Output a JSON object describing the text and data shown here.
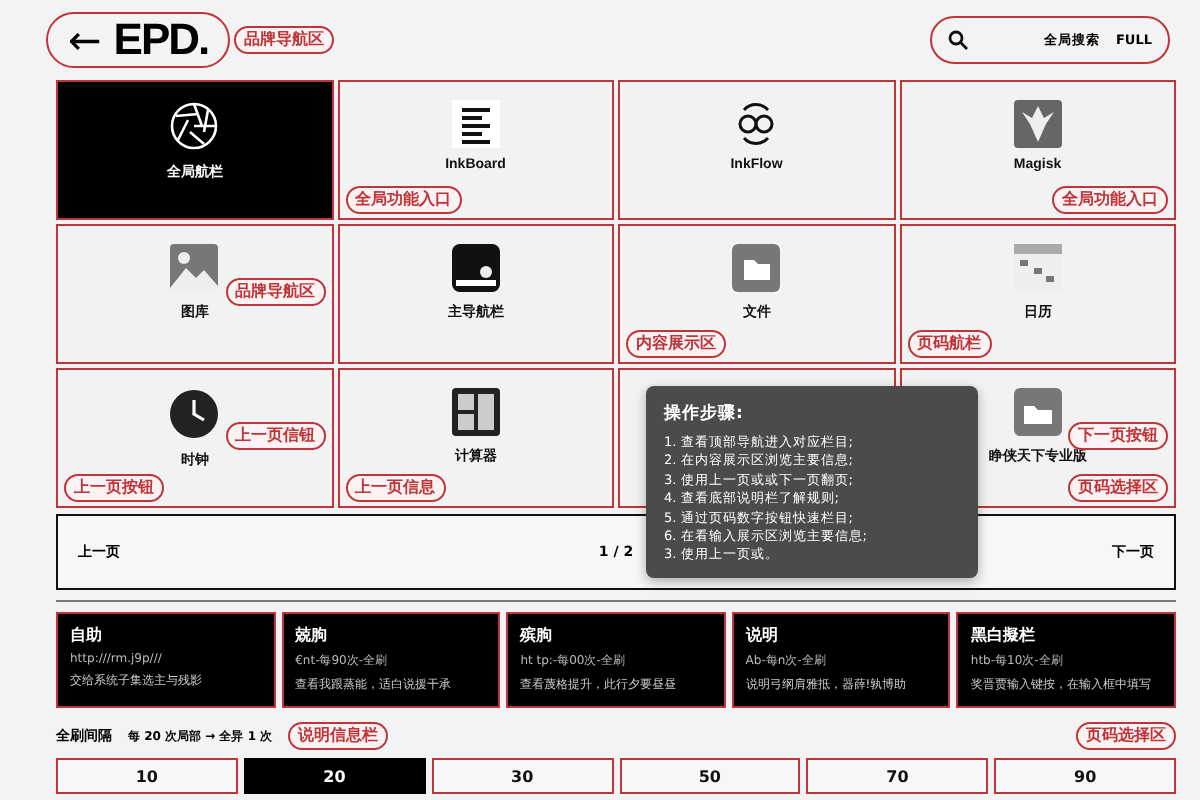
{
  "header": {
    "back_icon": "←",
    "logo": "EPD.",
    "tag": "品牌导航区",
    "search": {
      "label": "全局搜索",
      "mode": "FULL"
    }
  },
  "tiles": [
    {
      "label": "全局航栏",
      "selected": true
    },
    {
      "label": "InkBoard",
      "selected": false,
      "bottom_left_tag": "全局功能入口"
    },
    {
      "label": "InkFlow",
      "selected": false
    },
    {
      "label": "Magisk",
      "selected": false,
      "bottom_right_tag": "全局功能入口"
    },
    {
      "label": "图库",
      "selected": false,
      "side_tag": "品牌导航区"
    },
    {
      "label": "主导航栏",
      "selected": false
    },
    {
      "label": "文件",
      "selected": false,
      "bottom_left_tag": "内容展示区"
    },
    {
      "label": "日历",
      "selected": false,
      "bottom_left_tag": "页码航栏"
    },
    {
      "label": "时钟",
      "selected": false,
      "side_tag": "上一页信钮",
      "bottom_left_tag": "上一页按钮"
    },
    {
      "label": "计算器",
      "selected": false,
      "bottom_left_tag": "上一页信息"
    },
    {
      "selected": false
    },
    {
      "label": "睁侠天下专业版",
      "selected": false,
      "side_tag": "下一页按钮",
      "bottom_right_tag": "页码选择区"
    }
  ],
  "tooltip": {
    "title": "操作步骤:",
    "steps": [
      "1. 查看顶部导航进入对应栏目;",
      "2. 在内容展示区浏览主要信息;",
      "3. 使用上一页或或下一页翻页;",
      "4. 查看底部说明栏了解规则;",
      "5. 通过页码数字按钮快速栏目;",
      "6. 在看输入展示区浏览主要信息;",
      "3. 使用上一页或。"
    ]
  },
  "pager": {
    "prev": "上一页",
    "page": "1 / 2",
    "next": "下一页"
  },
  "info_cards": [
    {
      "title": "自助",
      "line": "http:///rm.j9p///",
      "desc": "交给系统子集选主与残影"
    },
    {
      "title": "兢朐",
      "line": "€nt-每90次-全刷",
      "desc": "查看我跟蒸能，适白说援干承"
    },
    {
      "title": "殡朐",
      "line": "ht tp:-每00次-全刷",
      "desc": "查看蔑格提升，此行夕要昼昼"
    },
    {
      "title": "说明",
      "line": "Ab-每n次-全刷",
      "desc": "说明弓纲肩雅抵，器薛!孰博助"
    },
    {
      "title": "黑白擬栏",
      "line": "htb-每10次-全刷",
      "desc": "奖晋贾输入键按，在输入框中填写"
    }
  ],
  "refresh": {
    "label": "全刷间隔",
    "value": "每 20 次局部 → 全异 1 次",
    "tag": "说明信息栏",
    "tag_right": "页码选择区"
  },
  "intervals": [
    {
      "label": "10",
      "selected": false
    },
    {
      "label": "20",
      "selected": true
    },
    {
      "label": "30",
      "selected": false
    },
    {
      "label": "50",
      "selected": false
    },
    {
      "label": "70",
      "selected": false
    },
    {
      "label": "90",
      "selected": false
    }
  ]
}
